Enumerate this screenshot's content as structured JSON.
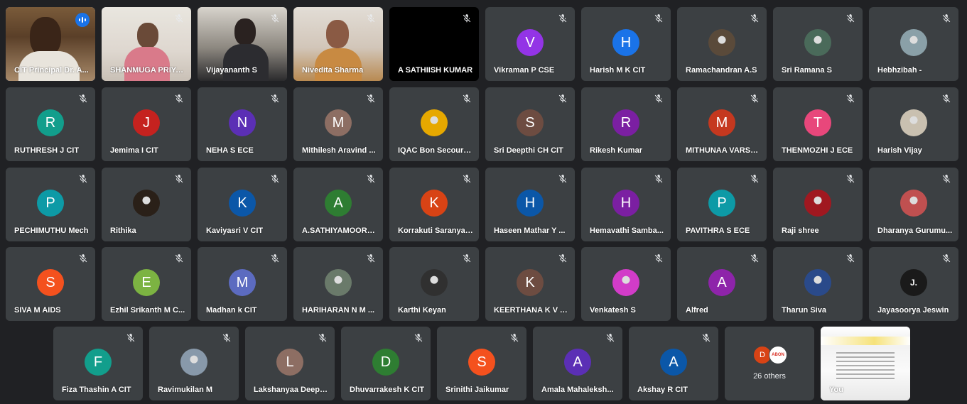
{
  "tiles": [
    {
      "name": "CIT Principal Dr. A...",
      "type": "video",
      "speaking": true
    },
    {
      "name": "SHANMUGA PRIYA...",
      "type": "video"
    },
    {
      "name": "Vijayananth S",
      "type": "video"
    },
    {
      "name": "Nivedita Sharma",
      "type": "video"
    },
    {
      "name": "A SATHIISH KUMAR",
      "type": "black"
    },
    {
      "name": "Vikraman P CSE",
      "initial": "V",
      "color": "#9334e6"
    },
    {
      "name": "Harish M K CIT",
      "initial": "H",
      "color": "#1a73e8"
    },
    {
      "name": "Ramachandran A.S",
      "photo": "#5a4a3a"
    },
    {
      "name": "Sri Ramana S",
      "photo": "#4a6a5a"
    },
    {
      "name": "Hebhzibah -",
      "photo": "#8aa0a8"
    },
    {
      "name": "RUTHRESH J CIT",
      "initial": "R",
      "color": "#129e8c"
    },
    {
      "name": "Jemima I CIT",
      "initial": "J",
      "color": "#c5221f"
    },
    {
      "name": "NEHA S ECE",
      "initial": "N",
      "color": "#5b2fb5"
    },
    {
      "name": "Mithilesh Aravind ...",
      "initial": "M",
      "color": "#8d6e63"
    },
    {
      "name": "IQAC Bon Secours ...",
      "photo": "#e6a800"
    },
    {
      "name": "Sri Deepthi CH CIT",
      "initial": "S",
      "color": "#6d4c41"
    },
    {
      "name": "Rikesh Kumar",
      "initial": "R",
      "color": "#7b1fa2"
    },
    {
      "name": "MITHUNAA VARSH...",
      "initial": "M",
      "color": "#c5381f"
    },
    {
      "name": "THENMOZHI J ECE",
      "initial": "T",
      "color": "#e8477b"
    },
    {
      "name": "Harish Vijay",
      "photo": "#c9c0b0"
    },
    {
      "name": "PECHIMUTHU Mech",
      "initial": "P",
      "color": "#0d9aa6"
    },
    {
      "name": "Rithika",
      "photo": "#2a2018"
    },
    {
      "name": "Kaviyasri V CIT",
      "initial": "K",
      "color": "#0b57a8"
    },
    {
      "name": "A.SATHIYAMOORT...",
      "initial": "A",
      "color": "#2e7d32"
    },
    {
      "name": "Korrakuti Saranya ...",
      "initial": "K",
      "color": "#d84315"
    },
    {
      "name": "Haseen Mathar Y ...",
      "initial": "H",
      "color": "#0b57a8"
    },
    {
      "name": "Hemavathi Samba...",
      "initial": "H",
      "color": "#7b1fa2"
    },
    {
      "name": "PAVITHRA S ECE",
      "initial": "P",
      "color": "#0d9aa6"
    },
    {
      "name": "Raji shree",
      "photo": "#a01820"
    },
    {
      "name": "Dharanya Gurumu...",
      "photo": "#c05050"
    },
    {
      "name": "SIVA M AIDS",
      "initial": "S",
      "color": "#f4511e"
    },
    {
      "name": "Ezhil Srikanth M C...",
      "initial": "E",
      "color": "#7cb342"
    },
    {
      "name": "Madhan k CIT",
      "initial": "M",
      "color": "#5c6bc0"
    },
    {
      "name": "HARIHARAN N M ...",
      "photo": "#6a7a6a"
    },
    {
      "name": "Karthi Keyan",
      "photo": "#303030"
    },
    {
      "name": "KEERTHANA K V AI...",
      "initial": "K",
      "color": "#6d4c41"
    },
    {
      "name": "Venkatesh S",
      "photo": "#d23cc8"
    },
    {
      "name": "Alfred",
      "initial": "A",
      "color": "#8e24aa"
    },
    {
      "name": "Tharun Siva",
      "photo": "#2a4a8a"
    },
    {
      "name": "Jayasoorya Jeswin",
      "photo": "#1a1a1a",
      "photoText": "J."
    },
    {
      "name": "Fiza Thashin A CIT",
      "initial": "F",
      "color": "#129e8c"
    },
    {
      "name": "Ravimukilan M",
      "photo": "#8899aa"
    },
    {
      "name": "Lakshanyaa Deepa...",
      "initial": "L",
      "color": "#8d6e63"
    },
    {
      "name": "Dhuvarrakesh K CIT",
      "initial": "D",
      "color": "#2e7d32"
    },
    {
      "name": "Srinithi Jaikumar",
      "initial": "S",
      "color": "#f4511e"
    },
    {
      "name": "Amala Mahaleksh...",
      "initial": "A",
      "color": "#5b2fb5"
    },
    {
      "name": "Akshay R CIT",
      "initial": "A",
      "color": "#0b57a8"
    },
    {
      "name": "",
      "type": "others"
    },
    {
      "name": "You",
      "type": "screen"
    }
  ],
  "others": {
    "label": "26 others",
    "avatar1": "D",
    "avatar1_color": "#d84315",
    "avatar2": "ABON",
    "avatar2_color": "#ffffff"
  },
  "icons": {
    "muted": "mic-off-icon",
    "speaking": "audio-bars-icon"
  }
}
